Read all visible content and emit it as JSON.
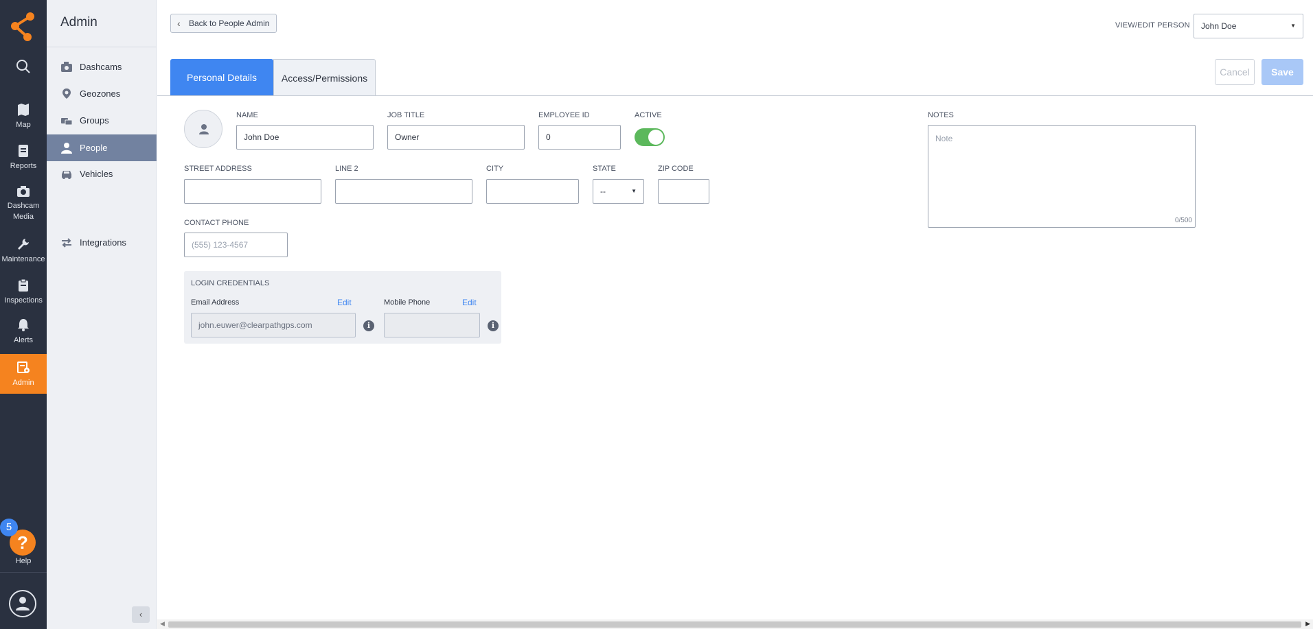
{
  "rail": {
    "items": [
      {
        "label": "Map"
      },
      {
        "label": "Reports"
      },
      {
        "label": "Dashcam Media"
      },
      {
        "label": "Maintenance"
      },
      {
        "label": "Inspections"
      },
      {
        "label": "Alerts"
      },
      {
        "label": "Admin"
      }
    ],
    "help": {
      "badge": "5",
      "glyph": "?",
      "label": "Help"
    },
    "accent_color": "#f5831f"
  },
  "sidebar": {
    "title": "Admin",
    "items": [
      {
        "label": "Dashcams",
        "icon": "camera-icon"
      },
      {
        "label": "Geozones",
        "icon": "map-pin-icon"
      },
      {
        "label": "Groups",
        "icon": "vehicles-group-icon"
      },
      {
        "label": "People",
        "icon": "person-icon",
        "active": true
      },
      {
        "label": "Vehicles",
        "icon": "car-icon"
      },
      {
        "label": "Integrations",
        "icon": "swap-arrows-icon"
      }
    ]
  },
  "header": {
    "back_label": "Back to People Admin",
    "view_edit_label": "VIEW/EDIT PERSON",
    "selected_person": "John Doe"
  },
  "tabs": [
    {
      "label": "Personal Details",
      "active": true
    },
    {
      "label": "Access/Permissions",
      "active": false
    }
  ],
  "actions": {
    "cancel": "Cancel",
    "save": "Save"
  },
  "form": {
    "name": {
      "label": "NAME",
      "value": "John Doe"
    },
    "job_title": {
      "label": "JOB TITLE",
      "value": "Owner"
    },
    "employee_id": {
      "label": "EMPLOYEE ID",
      "value": "0"
    },
    "active": {
      "label": "ACTIVE",
      "on": true
    },
    "street": {
      "label": "STREET ADDRESS",
      "value": ""
    },
    "line2": {
      "label": "LINE 2",
      "value": ""
    },
    "city": {
      "label": "CITY",
      "value": ""
    },
    "state": {
      "label": "STATE",
      "value": "--"
    },
    "zip": {
      "label": "ZIP CODE",
      "value": ""
    },
    "phone": {
      "label": "CONTACT PHONE",
      "placeholder": "(555) 123-4567"
    },
    "notes": {
      "label": "NOTES",
      "placeholder": "Note",
      "counter": "0/500"
    }
  },
  "credentials": {
    "title": "LOGIN CREDENTIALS",
    "email_label": "Email Address",
    "email_edit": "Edit",
    "email_value": "john.euwer@clearpathgps.com",
    "mobile_label": "Mobile Phone",
    "mobile_edit": "Edit",
    "mobile_value": "",
    "info_glyph": "i"
  },
  "colors": {
    "primary": "#3f86f1",
    "toggle_on": "#5cb85c",
    "rail_bg": "#2a3140"
  }
}
